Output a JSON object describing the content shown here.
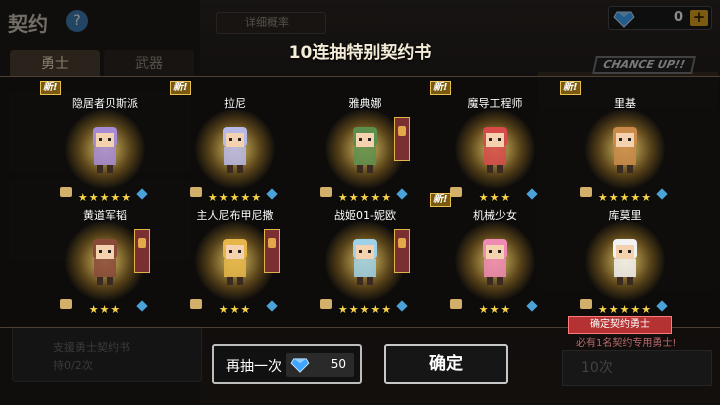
{
  "background": {
    "title": "契约",
    "help": "?",
    "tabs": [
      "勇士",
      "武器"
    ],
    "info_button": "详细概率",
    "chance_banner": "CHANCE UP!!",
    "bottom_left_label": "支援勇士契约书",
    "bottom_left_sub": "持0/2次",
    "ten_pull_button": "10次"
  },
  "currency": {
    "icon": "diamond-icon",
    "value": "0",
    "plus": "+"
  },
  "panel": {
    "title": "10连抽特别契约书",
    "new_label": "新!"
  },
  "heroes": [
    {
      "name": "隐居者贝斯派",
      "stars": 5,
      "is_new": true,
      "flag": false,
      "accent": "#a58bd6"
    },
    {
      "name": "拉尼",
      "stars": 5,
      "is_new": true,
      "flag": false,
      "accent": "#b9b9e8"
    },
    {
      "name": "雅典娜",
      "stars": 5,
      "is_new": false,
      "flag": true,
      "accent": "#5d8f4c"
    },
    {
      "name": "魔导工程师",
      "stars": 3,
      "is_new": true,
      "flag": false,
      "accent": "#d64a4a"
    },
    {
      "name": "里基",
      "stars": 5,
      "is_new": true,
      "flag": false,
      "accent": "#c98a4a"
    },
    {
      "name": "黄道军韬",
      "stars": 3,
      "is_new": false,
      "flag": true,
      "accent": "#8a4a3a"
    },
    {
      "name": "主人尼布甲尼撒",
      "stars": 3,
      "is_new": false,
      "flag": true,
      "accent": "#e6b64a"
    },
    {
      "name": "战姬01-妮欧",
      "stars": 5,
      "is_new": false,
      "flag": true,
      "accent": "#9fd1e8"
    },
    {
      "name": "机械少女",
      "stars": 3,
      "is_new": true,
      "flag": false,
      "accent": "#f08ab5"
    },
    {
      "name": "库莫里",
      "stars": 5,
      "is_new": false,
      "flag": false,
      "accent": "#f2f2f2"
    }
  ],
  "actions": {
    "again_label": "再抽一次",
    "again_cost": "50",
    "confirm_label": "确定",
    "ribbon": "确定契约勇士",
    "ribbon_sub": "必有1名契约专用勇士!"
  }
}
